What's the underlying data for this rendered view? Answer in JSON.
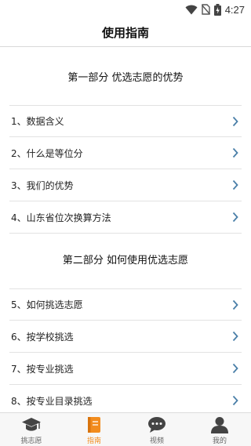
{
  "status_bar": {
    "time": "4:27"
  },
  "header": {
    "title": "使用指南"
  },
  "section1": {
    "title": "第一部分 优选志愿的优势",
    "items": [
      {
        "label": "1、数据含义"
      },
      {
        "label": "2、什么是等位分"
      },
      {
        "label": "3、我们的优势"
      },
      {
        "label": "4、山东省位次换算方法"
      }
    ]
  },
  "section2": {
    "title": "第二部分 如何使用优选志愿",
    "items": [
      {
        "label": "5、如何挑选志愿"
      },
      {
        "label": "6、按学校挑选"
      },
      {
        "label": "7、按专业挑选"
      },
      {
        "label": "8、按专业目录挑选"
      }
    ]
  },
  "tabs": [
    {
      "label": "挑志愿",
      "icon": "graduation-cap-icon",
      "active": false
    },
    {
      "label": "指南",
      "icon": "book-icon",
      "active": true
    },
    {
      "label": "视频",
      "icon": "chat-bubble-icon",
      "active": false
    },
    {
      "label": "我的",
      "icon": "person-icon",
      "active": false
    }
  ],
  "colors": {
    "accent": "#f28c1e",
    "chevron": "#4a7fa8",
    "tab_icon": "#444444"
  }
}
